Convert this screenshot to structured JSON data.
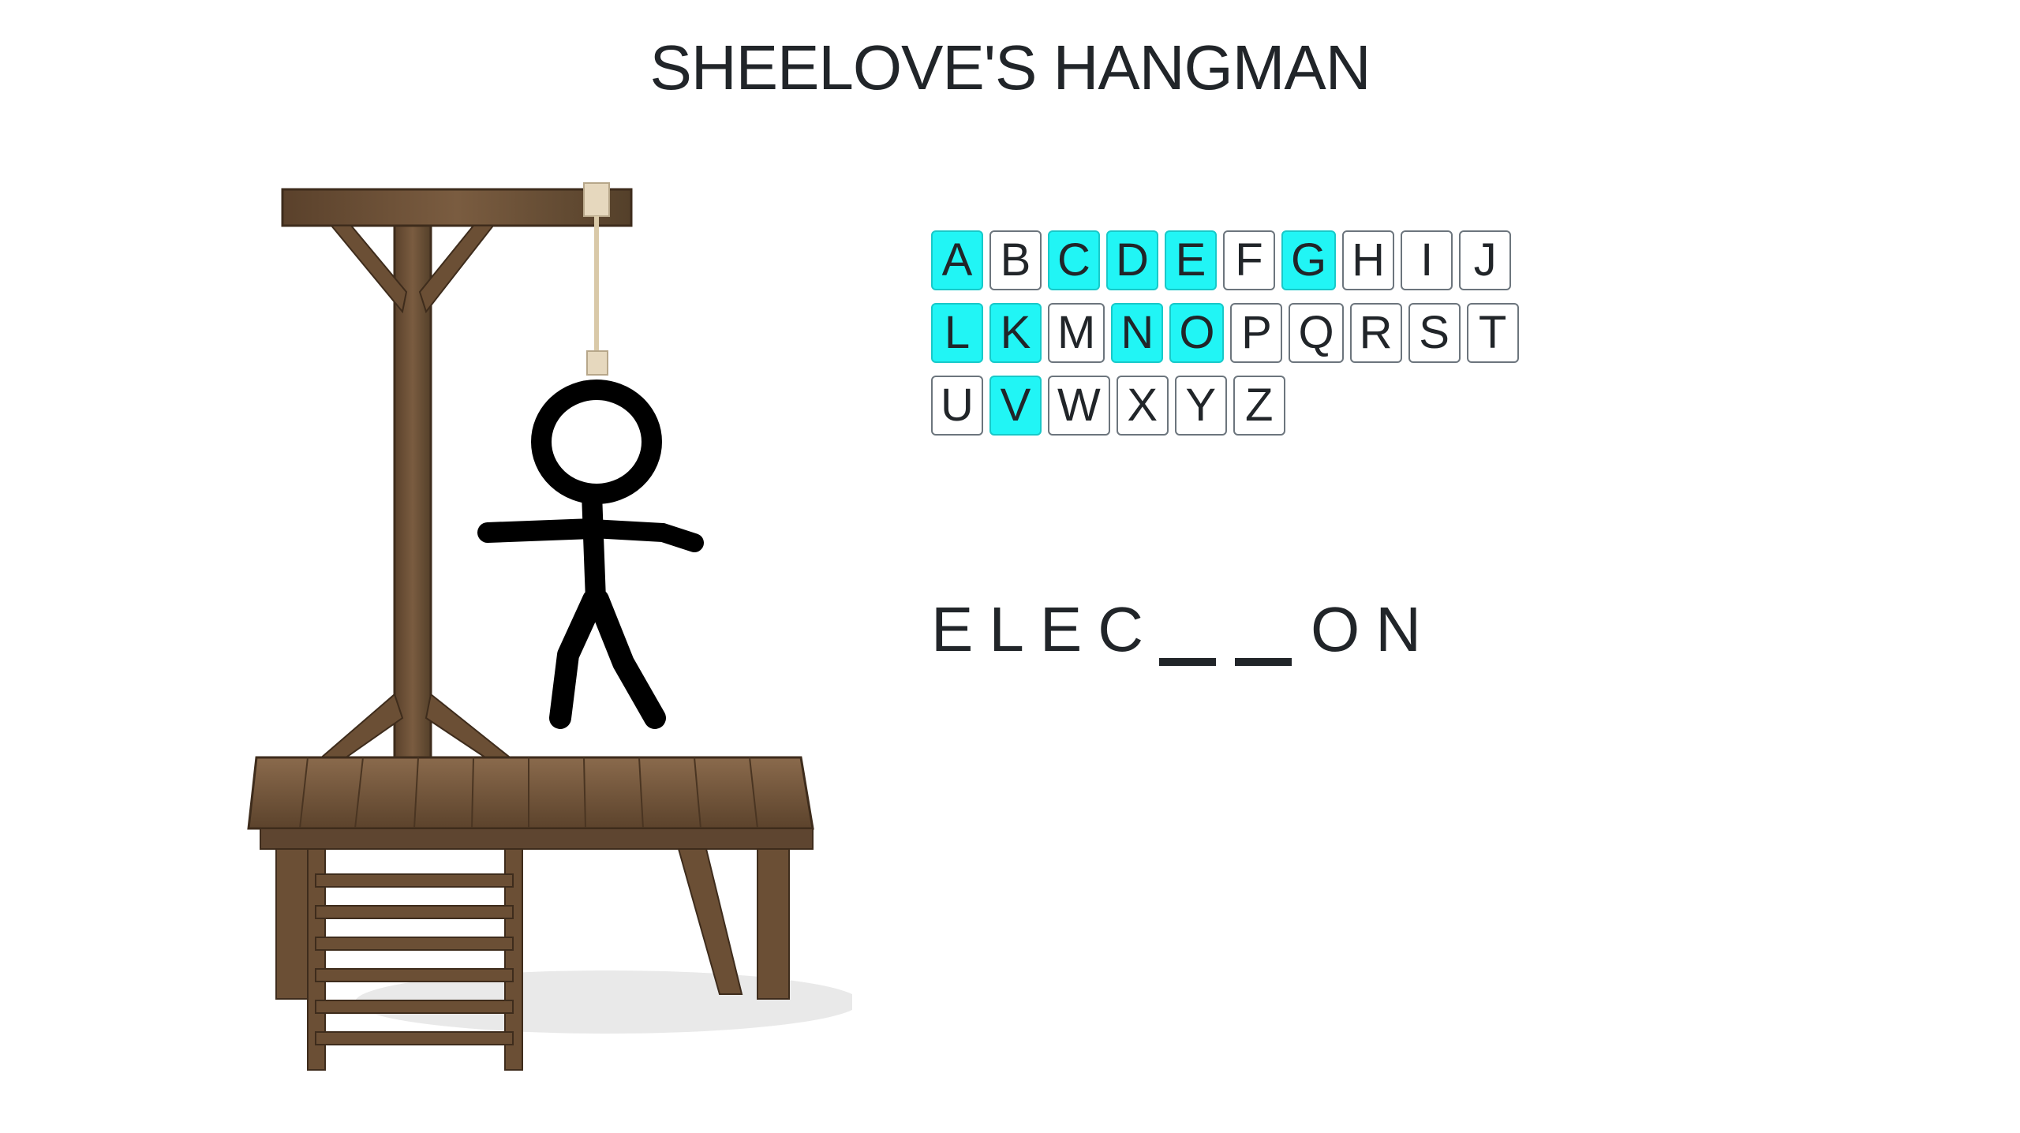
{
  "title": "SHEELOVE'S HANGMAN",
  "colors": {
    "guessed_key": "#21f5f5",
    "wood": "#6b4f35",
    "figure": "#000000",
    "text": "#212529"
  },
  "keyboard": {
    "rows": [
      [
        {
          "letter": "A",
          "used": true
        },
        {
          "letter": "B",
          "used": false
        },
        {
          "letter": "C",
          "used": true
        },
        {
          "letter": "D",
          "used": true
        },
        {
          "letter": "E",
          "used": true
        },
        {
          "letter": "F",
          "used": false
        },
        {
          "letter": "G",
          "used": true
        },
        {
          "letter": "H",
          "used": false
        },
        {
          "letter": "I",
          "used": false
        },
        {
          "letter": "J",
          "used": false
        }
      ],
      [
        {
          "letter": "L",
          "used": true
        },
        {
          "letter": "K",
          "used": true
        },
        {
          "letter": "M",
          "used": false
        },
        {
          "letter": "N",
          "used": true
        },
        {
          "letter": "O",
          "used": true
        },
        {
          "letter": "P",
          "used": false
        },
        {
          "letter": "Q",
          "used": false
        },
        {
          "letter": "R",
          "used": false
        },
        {
          "letter": "S",
          "used": false
        },
        {
          "letter": "T",
          "used": false
        }
      ],
      [
        {
          "letter": "U",
          "used": false
        },
        {
          "letter": "V",
          "used": true
        },
        {
          "letter": "W",
          "used": false
        },
        {
          "letter": "X",
          "used": false
        },
        {
          "letter": "Y",
          "used": false
        },
        {
          "letter": "Z",
          "used": false
        }
      ]
    ]
  },
  "word": {
    "slots": [
      "E",
      "L",
      "E",
      "C",
      "",
      "",
      "O",
      "N"
    ]
  },
  "hangman": {
    "parts_shown": [
      "head",
      "body",
      "left-arm",
      "right-arm",
      "left-leg",
      "right-leg"
    ]
  }
}
